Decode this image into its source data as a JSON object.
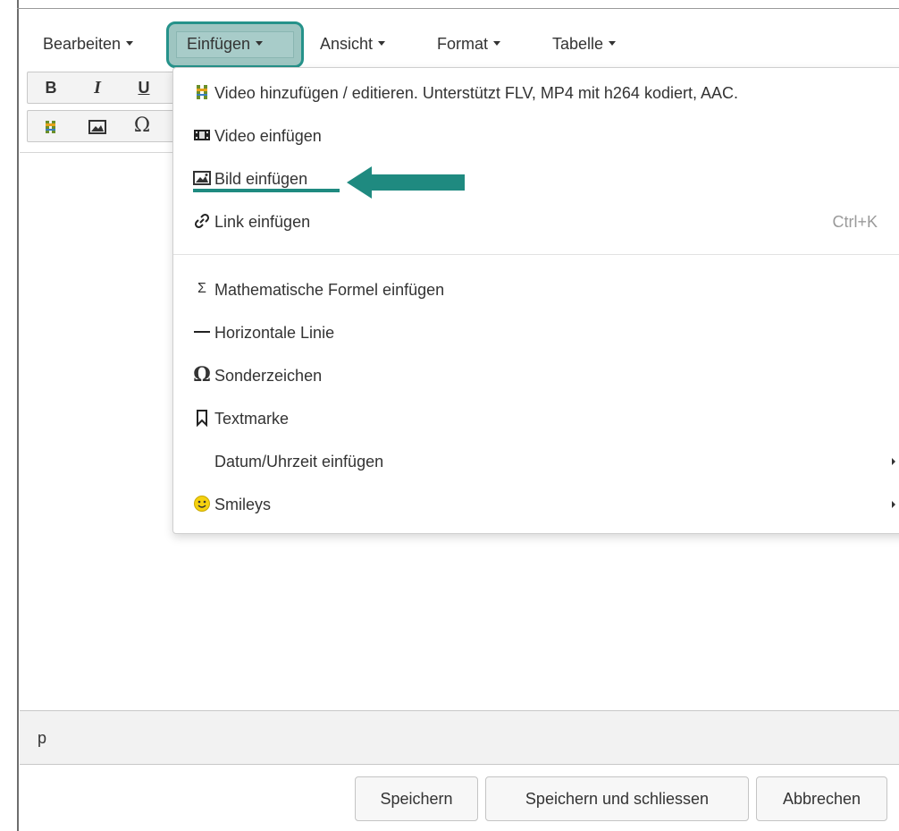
{
  "menubar": {
    "items": [
      {
        "label": "Bearbeiten"
      },
      {
        "label": "Einfügen"
      },
      {
        "label": "Ansicht"
      },
      {
        "label": "Format"
      },
      {
        "label": "Tabelle"
      }
    ]
  },
  "toolbar": {
    "bold": "B",
    "italic": "I",
    "underline": "U",
    "omega": "Ω"
  },
  "insert_menu": {
    "items": [
      {
        "label": "Video hinzufügen / editieren. Unterstützt FLV, MP4 mit h264 kodiert, AAC.",
        "icon": "film-strip-icon"
      },
      {
        "label": "Video einfügen",
        "icon": "video-icon"
      },
      {
        "label": "Bild einfügen",
        "icon": "image-icon"
      },
      {
        "label": "Link einfügen",
        "icon": "link-icon",
        "shortcut": "Ctrl+K"
      },
      {
        "label": "Mathematische Formel einfügen",
        "icon": "sigma-icon",
        "symbol": "Σ"
      },
      {
        "label": "Horizontale Linie",
        "icon": "horizontal-line-icon"
      },
      {
        "label": "Sonderzeichen",
        "icon": "omega-icon",
        "symbol": "Ω"
      },
      {
        "label": "Textmarke",
        "icon": "bookmark-icon"
      },
      {
        "label": "Datum/Uhrzeit einfügen"
      },
      {
        "label": "Smileys",
        "icon": "smiley-icon"
      }
    ]
  },
  "statusbar": {
    "path": "p"
  },
  "footer": {
    "save": "Speichern",
    "save_close": "Speichern und schliessen",
    "cancel": "Abbrechen"
  },
  "colors": {
    "highlight_teal": "#1f8a80",
    "active_menu_fill": "#9ec5c1"
  }
}
